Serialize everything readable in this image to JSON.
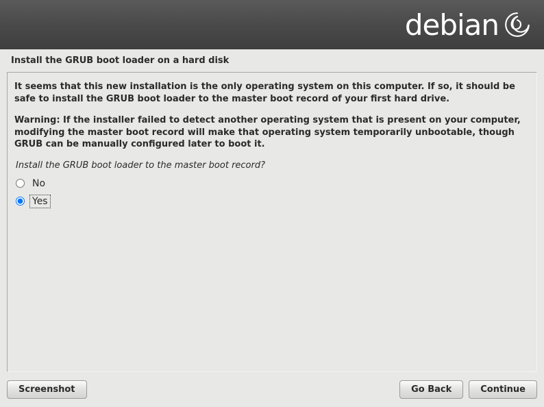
{
  "brand": "debian",
  "page_title": "Install the GRUB boot loader on a hard disk",
  "info_paragraph_1": "It seems that this new installation is the only operating system on this computer. If so, it should be safe to install the GRUB boot loader to the master boot record of your first hard drive.",
  "info_paragraph_2": "Warning: If the installer failed to detect another operating system that is present on your computer, modifying the master boot record will make that operating system temporarily unbootable, though GRUB can be manually configured later to boot it.",
  "question": "Install the GRUB boot loader to the master boot record?",
  "options": {
    "no": "No",
    "yes": "Yes"
  },
  "selected_option": "yes",
  "buttons": {
    "screenshot": "Screenshot",
    "go_back": "Go Back",
    "continue": "Continue"
  }
}
